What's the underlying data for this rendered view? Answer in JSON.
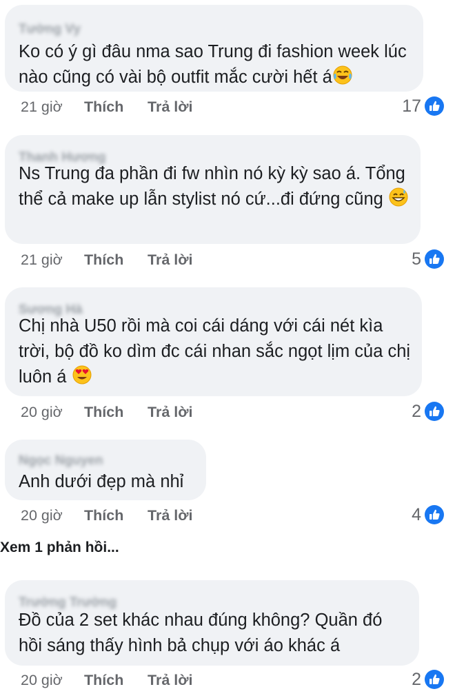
{
  "comments": [
    {
      "author": "Tường Vy",
      "text": "Ko có ý gì đâu nma sao Trung đi fashion week lúc nào cũng có vài bộ outfit mắc cười hết á",
      "emoji": "laughing-tears",
      "time": "21 giờ",
      "like_label": "Thích",
      "reply_label": "Trả lời",
      "reactions": "17"
    },
    {
      "author": "Thanh Hương",
      "text": "Ns Trung đa phần đi fw nhìn nó kỳ kỳ sao á. Tổng thể cả make up lẫn stylist nó cứ...đi đứng cũng",
      "emoji": "grinning-sweat",
      "time": "21 giờ",
      "like_label": "Thích",
      "reply_label": "Trả lời",
      "reactions": "5"
    },
    {
      "author": "Sương Hà",
      "text": "Chị nhà U50 rồi mà coi cái dáng với cái nét kìa trời, bộ đồ ko dìm đc cái nhan sắc ngọt lịm của chị luôn á",
      "emoji": "heart-eyes",
      "time": "20 giờ",
      "like_label": "Thích",
      "reply_label": "Trả lời",
      "reactions": "2"
    },
    {
      "author": "Ngọc Nguyen",
      "text": "Anh dưới đẹp mà nhỉ",
      "emoji": "",
      "time": "20 giờ",
      "like_label": "Thích",
      "reply_label": "Trả lời",
      "reactions": "4"
    },
    {
      "author": "Trường Trường",
      "text": "Đồ của 2 set khác nhau đúng không? Quần đó hồi sáng thấy hình bả chụp với áo khác á",
      "emoji": "",
      "time": "20 giờ",
      "like_label": "Thích",
      "reply_label": "Trả lời",
      "reactions": "2"
    }
  ],
  "view_replies": "Xem 1 phản hồi...",
  "colors": {
    "bubble": "#f0f2f5",
    "meta_text": "#65676b",
    "like_blue": "#1877f2"
  }
}
